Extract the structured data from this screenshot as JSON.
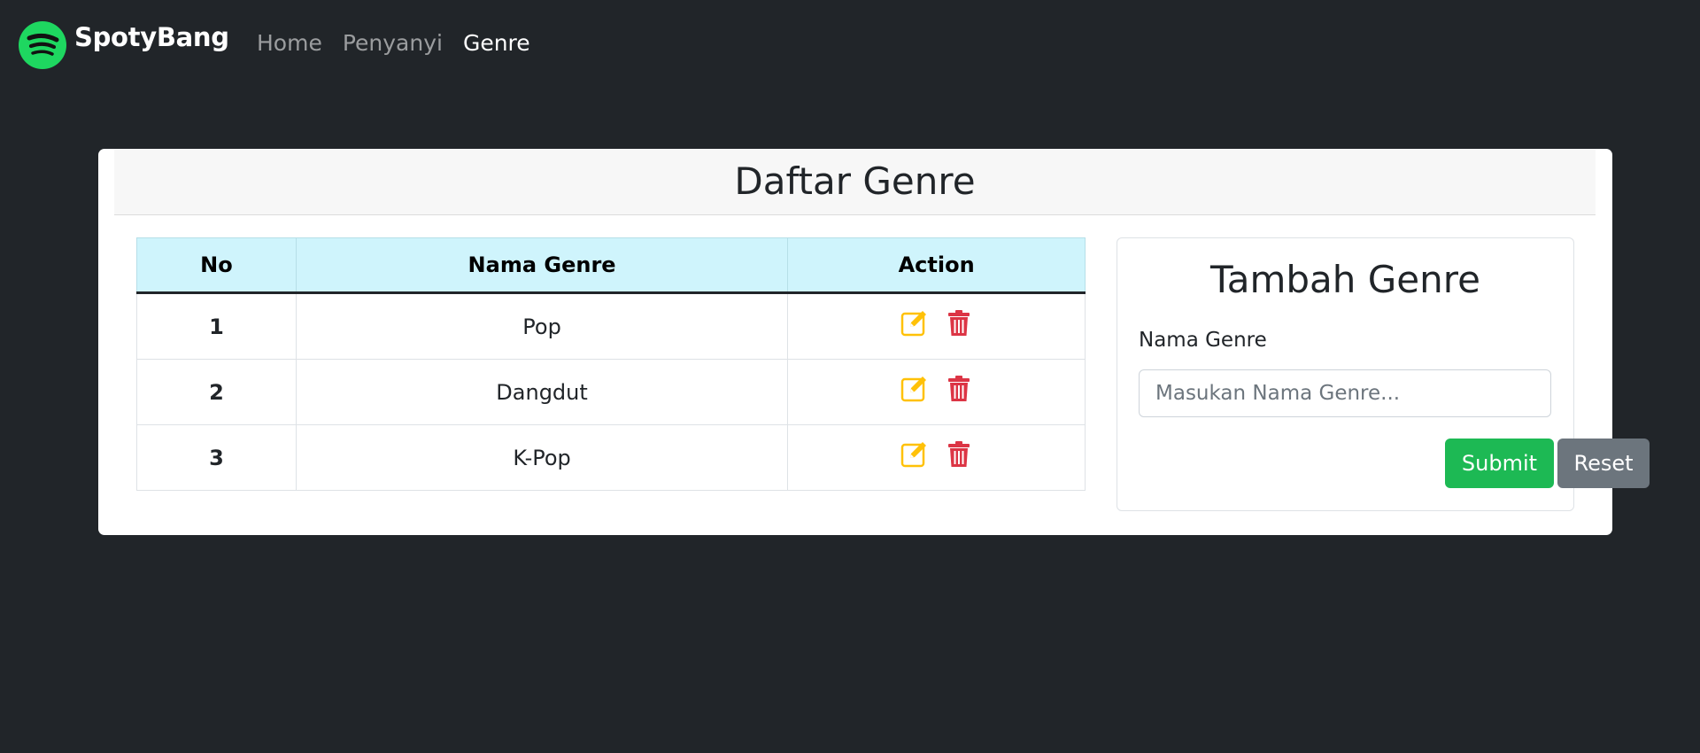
{
  "nav": {
    "brand": "SpotyBang",
    "links": [
      {
        "label": "Home",
        "active": false
      },
      {
        "label": "Penyanyi",
        "active": false
      },
      {
        "label": "Genre",
        "active": true
      }
    ]
  },
  "page": {
    "title": "Daftar Genre"
  },
  "table": {
    "headers": [
      "No",
      "Nama Genre",
      "Action"
    ],
    "rows": [
      {
        "no": "1",
        "name": "Pop"
      },
      {
        "no": "2",
        "name": "Dangdut"
      },
      {
        "no": "3",
        "name": "K-Pop"
      }
    ],
    "icons": {
      "edit": "edit-icon",
      "delete": "trash-icon"
    }
  },
  "form": {
    "title": "Tambah Genre",
    "label": "Nama Genre",
    "placeholder": "Masukan Nama Genre...",
    "value": "",
    "submit_label": "Submit",
    "reset_label": "Reset"
  },
  "colors": {
    "background": "#212529",
    "brand_green": "#1db954",
    "table_header": "#cff4fc",
    "edit_icon": "#ffc107",
    "delete_icon": "#dc3545",
    "reset_button": "#6c757d"
  }
}
